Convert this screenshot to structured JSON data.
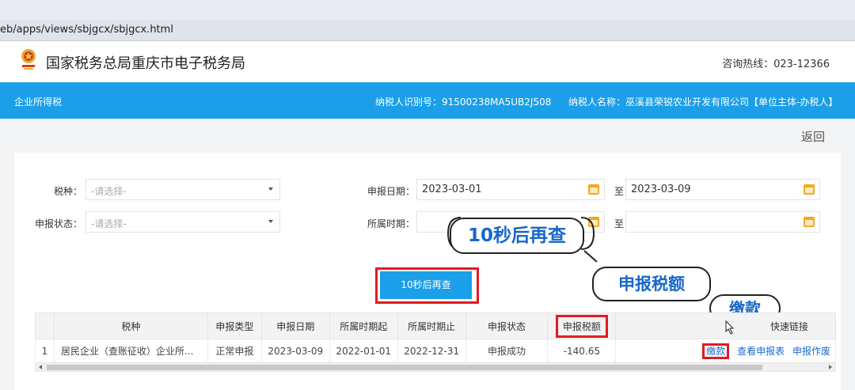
{
  "browser": {
    "url": "eb/apps/views/sbjgcx/sbjgcx.html"
  },
  "header": {
    "title": "国家税务总局重庆市电子税务局",
    "hotline": "咨询热线：023-12366"
  },
  "bluebar": {
    "module": "企业所得税",
    "taxpayer_id": "纳税人识别号：91500238MA5UB2J508",
    "taxpayer_name": "纳税人名称：巫溪县荣锐农业开发有限公司【单位主体-办税人】"
  },
  "back_label": "返回",
  "form": {
    "tax_type_label": "税种：",
    "tax_type_placeholder": "-请选择-",
    "status_label": "申报状态：",
    "status_placeholder": "-请选择-",
    "date_label": "申报日期：",
    "date_from": "2023-03-01",
    "date_to": "2023-03-09",
    "period_label": "所属时期：",
    "period_from": "",
    "period_to": "",
    "to_label": "至"
  },
  "requery_button": "10秒后再查",
  "callouts": {
    "requery": "10秒后再查",
    "tax_amount": "申报税额",
    "pay": "缴款"
  },
  "table": {
    "columns": [
      "",
      "税种",
      "申报类型",
      "申报日期",
      "所属时期起",
      "所属时期止",
      "申报状态",
      "申报税额",
      "快速链接"
    ],
    "rows": [
      {
        "index": "1",
        "tax_type": "居民企业（查账征收）企业所...",
        "decl_type": "正常申报",
        "decl_date": "2023-03-09",
        "period_start": "2022-01-01",
        "period_end": "2022-12-31",
        "status": "申报成功",
        "amount": "-140.65",
        "links": [
          "缴款",
          "查看申报表",
          "申报作废"
        ]
      }
    ]
  },
  "colors": {
    "primary": "#1a9fe8",
    "highlight_frame": "#e21a22",
    "link": "#1a6bd1",
    "callout_text": "#1767c9"
  }
}
